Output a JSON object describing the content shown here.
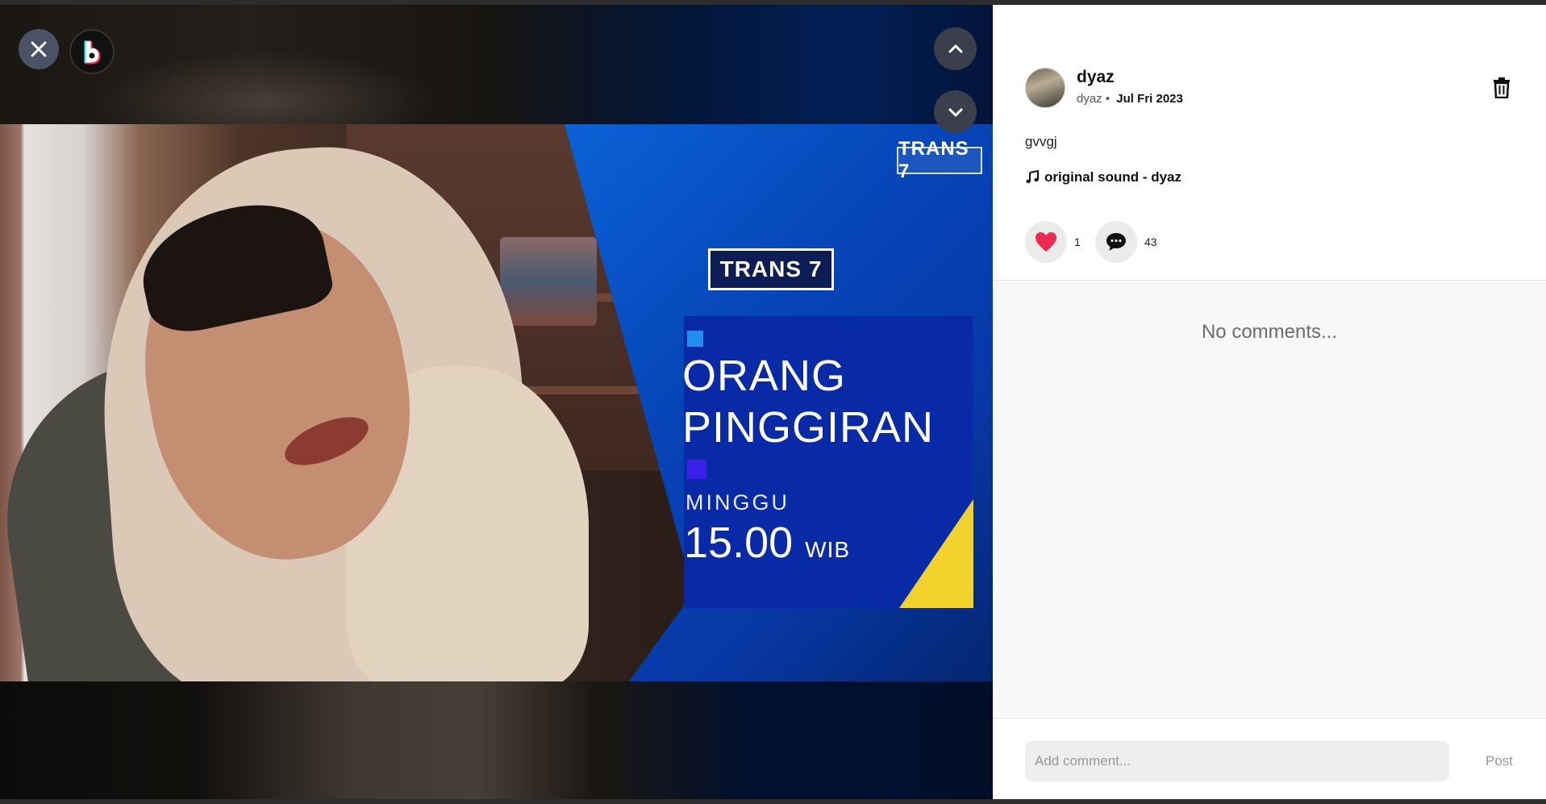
{
  "video": {
    "overlay": {
      "small_logo": "TRANS 7",
      "big_logo": "TRANS 7",
      "title_line1": "ORANG",
      "title_line2": "PINGGIRAN",
      "day": "MINGGU",
      "time": "15.00",
      "time_suffix": "WIB"
    },
    "controls": {
      "close_icon": "close-icon",
      "app_logo_icon": "app-logo-icon",
      "nav_up_icon": "chevron-up-icon",
      "nav_down_icon": "chevron-down-icon"
    }
  },
  "post": {
    "author_display_name": "dyaz",
    "author_handle": "dyaz",
    "separator": "•",
    "date": "Jul Fri 2023",
    "caption": "gvvgj",
    "sound": "original sound - dyaz",
    "likes": "1",
    "comments_count": "43"
  },
  "comments": {
    "empty_text": "No comments...",
    "input_placeholder": "Add comment...",
    "post_label": "Post"
  },
  "colors": {
    "like_heart": "#f0294f",
    "panel_bg": "#ffffff",
    "comments_bg": "#f8f8f8",
    "control_bg": "#4b5266"
  }
}
